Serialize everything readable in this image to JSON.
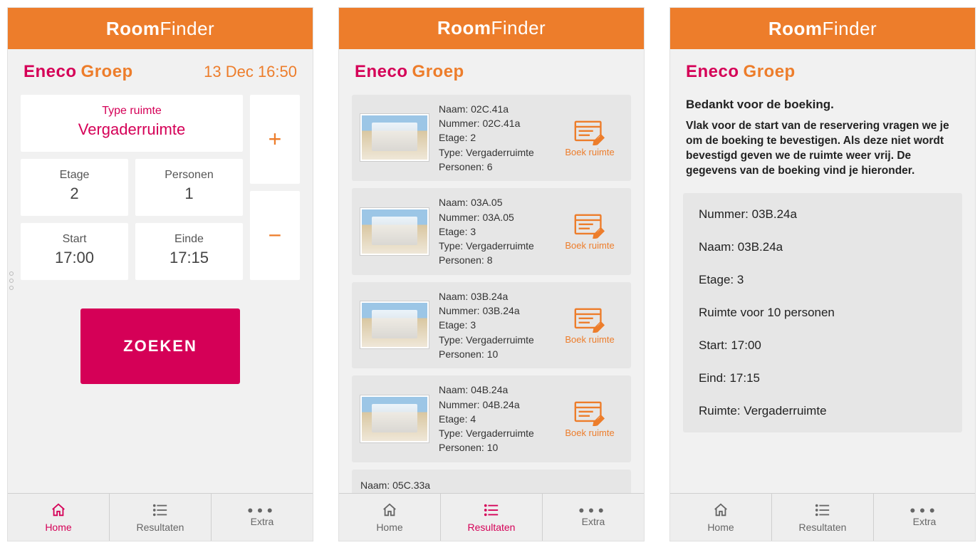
{
  "app": {
    "title_bold": "Room",
    "title_light": "Finder"
  },
  "brand": {
    "a": "Eneco",
    "b": "Groep"
  },
  "screen1": {
    "datetime": "13 Dec 16:50",
    "tiles": {
      "type": {
        "label": "Type ruimte",
        "value": "Vergaderruimte"
      },
      "floor": {
        "label": "Etage",
        "value": "2"
      },
      "persons": {
        "label": "Personen",
        "value": "1"
      },
      "start": {
        "label": "Start",
        "value": "17:00"
      },
      "end": {
        "label": "Einde",
        "value": "17:15"
      }
    },
    "search_label": "ZOEKEN",
    "plus": "+",
    "minus": "−"
  },
  "screen2": {
    "field_labels": {
      "name": "Naam",
      "number": "Nummer",
      "floor": "Etage",
      "type": "Type",
      "persons": "Personen"
    },
    "book_label": "Boek ruimte",
    "rooms": [
      {
        "name": "02C.41a",
        "number": "02C.41a",
        "floor": "2",
        "type": "Vergaderruimte",
        "persons": "6"
      },
      {
        "name": "03A.05",
        "number": "03A.05",
        "floor": "3",
        "type": "Vergaderruimte",
        "persons": "8"
      },
      {
        "name": "03B.24a",
        "number": "03B.24a",
        "floor": "3",
        "type": "Vergaderruimte",
        "persons": "10"
      },
      {
        "name": "04B.24a",
        "number": "04B.24a",
        "floor": "4",
        "type": "Vergaderruimte",
        "persons": "10"
      },
      {
        "name": "05C.33a",
        "number": "",
        "floor": "",
        "type": "",
        "persons": ""
      }
    ]
  },
  "screen3": {
    "thanks_title": "Bedankt voor de boeking.",
    "thanks_body": "Vlak voor de start van de reservering vragen we je om de boeking te bevestigen. Als deze niet wordt bevestigd geven we de ruimte weer vrij. De gegevens van de boeking vind je hieronder.",
    "details": {
      "number": "Nummer: 03B.24a",
      "name": "Naam: 03B.24a",
      "floor": "Etage: 3",
      "capacity": "Ruimte voor 10 personen",
      "start": "Start: 17:00",
      "end": "Eind: 17:15",
      "type": "Ruimte: Vergaderruimte"
    }
  },
  "tabs": {
    "home": "Home",
    "results": "Resultaten",
    "extra": "Extra"
  }
}
